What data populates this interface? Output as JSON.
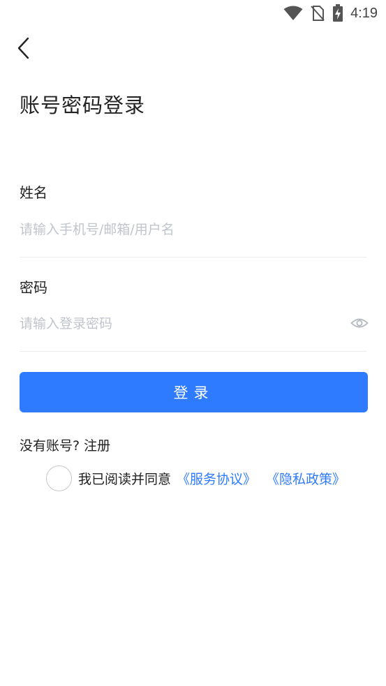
{
  "status_bar": {
    "time": "4:19",
    "icons": [
      "wifi-icon",
      "no-sim-icon",
      "battery-charging-icon"
    ]
  },
  "header": {
    "back_icon": "chevron-left-icon",
    "title": "账号密码登录"
  },
  "form": {
    "username": {
      "label": "姓名",
      "placeholder": "请输入手机号/邮箱/用户名",
      "value": ""
    },
    "password": {
      "label": "密码",
      "placeholder": "请输入登录密码",
      "value": "",
      "toggle_icon": "eye-icon"
    },
    "submit_label": "登录"
  },
  "register": {
    "prompt": "没有账号? ",
    "link_label": "注册"
  },
  "agreement": {
    "checked": false,
    "text": "我已阅读并同意",
    "service_link": "《服务协议》",
    "privacy_link": "《隐私政策》"
  },
  "colors": {
    "primary": "#2f7bff",
    "placeholder": "#c0c4cc",
    "divider": "#ececec",
    "text": "#222222"
  }
}
